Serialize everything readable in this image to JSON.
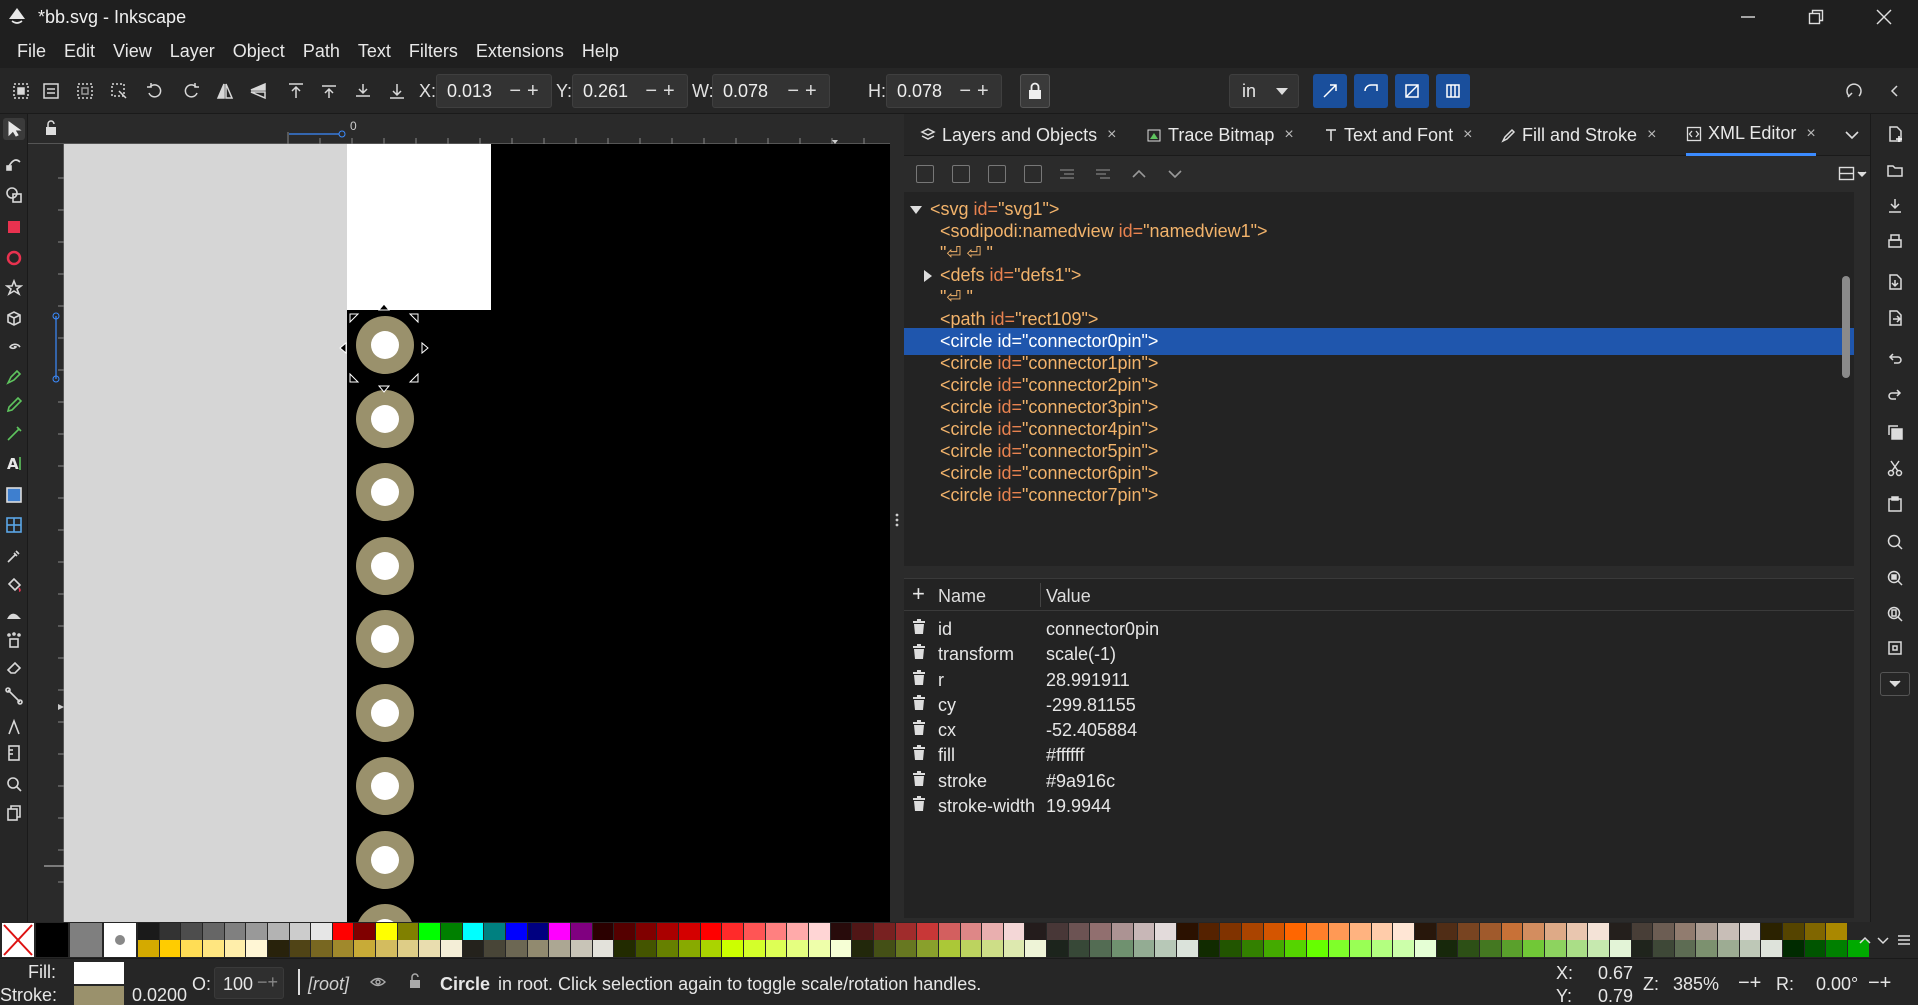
{
  "window": {
    "title": "*bb.svg - Inkscape"
  },
  "menu": [
    "File",
    "Edit",
    "View",
    "Layer",
    "Object",
    "Path",
    "Text",
    "Filters",
    "Extensions",
    "Help"
  ],
  "toolbar": {
    "x_label": "X:",
    "x_value": "0.013",
    "y_label": "Y:",
    "y_value": "0.261",
    "w_label": "W:",
    "w_value": "0.078",
    "h_label": "H:",
    "h_value": "0.078",
    "unit": "in",
    "pm": "−+"
  },
  "tabs": [
    {
      "label": "Layers and Objects",
      "icon": "layers-icon"
    },
    {
      "label": "Trace Bitmap",
      "icon": "trace-bitmap-icon"
    },
    {
      "label": "Text and Font",
      "icon": "text-font-icon"
    },
    {
      "label": "Fill and Stroke",
      "icon": "fill-stroke-icon"
    },
    {
      "label": "XML Editor",
      "icon": "xml-editor-icon",
      "active": true
    }
  ],
  "tab_close": "×",
  "xml_tree": [
    {
      "expander": "down",
      "tag": "<svg",
      "attr": " id=",
      "value": "\"svg1\"",
      "end": ">"
    },
    {
      "expander": "",
      "tag": "<sodipodi:namedview",
      "attr": " id=",
      "value": "\"namedview1\"",
      "end": ">"
    },
    {
      "expander": "",
      "text": "\"⏎ ⏎ \""
    },
    {
      "expander": "right",
      "tag": "<defs",
      "attr": " id=",
      "value": "\"defs1\"",
      "end": ">"
    },
    {
      "expander": "",
      "text": "\"⏎ \""
    },
    {
      "expander": "",
      "tag": "<path",
      "attr": " id=",
      "value": "\"rect109\"",
      "end": ">"
    },
    {
      "expander": "",
      "tag": "<circle",
      "attr": " id=",
      "value": "\"connector0pin\"",
      "end": ">",
      "selected": true
    },
    {
      "expander": "",
      "tag": "<circle",
      "attr": " id=",
      "value": "\"connector1pin\"",
      "end": ">"
    },
    {
      "expander": "",
      "tag": "<circle",
      "attr": " id=",
      "value": "\"connector2pin\"",
      "end": ">"
    },
    {
      "expander": "",
      "tag": "<circle",
      "attr": " id=",
      "value": "\"connector3pin\"",
      "end": ">"
    },
    {
      "expander": "",
      "tag": "<circle",
      "attr": " id=",
      "value": "\"connector4pin\"",
      "end": ">"
    },
    {
      "expander": "",
      "tag": "<circle",
      "attr": " id=",
      "value": "\"connector5pin\"",
      "end": ">"
    },
    {
      "expander": "",
      "tag": "<circle",
      "attr": " id=",
      "value": "\"connector6pin\"",
      "end": ">"
    },
    {
      "expander": "",
      "tag": "<circle",
      "attr": " id=",
      "value": "\"connector7pin\"",
      "end": ">"
    }
  ],
  "attributes": {
    "add": "+",
    "header_name": "Name",
    "header_value": "Value",
    "rows": [
      {
        "name": "id",
        "value": "connector0pin"
      },
      {
        "name": "transform",
        "value": "scale(-1)"
      },
      {
        "name": "r",
        "value": "28.991911"
      },
      {
        "name": "cy",
        "value": "-299.81155"
      },
      {
        "name": "cx",
        "value": "-52.405884"
      },
      {
        "name": "fill",
        "value": "#ffffff"
      },
      {
        "name": "stroke",
        "value": "#9a916c"
      },
      {
        "name": "stroke-width",
        "value": "19.9944"
      }
    ]
  },
  "ruler": {
    "origin_label": "0"
  },
  "colors": {
    "pad": "#9a916c",
    "accent": "#1f56ad",
    "fill": "#ffffff",
    "stroke": "#9a916c"
  },
  "status": {
    "fill_label": "Fill:",
    "stroke_label": "Stroke:",
    "stroke_width": "0.0200",
    "opacity_label": "O:",
    "opacity_value": "100",
    "layer": "[root]",
    "object_type": "Circle",
    "message": "in root. Click selection again to toggle scale/rotation handles.",
    "cursor_x_label": "X:",
    "cursor_x": "0.67",
    "cursor_y_label": "Y:",
    "cursor_y": "0.79",
    "zoom_label": "Z:",
    "zoom": "385%",
    "rotation_label": "R:",
    "rotation": "0.00°"
  }
}
